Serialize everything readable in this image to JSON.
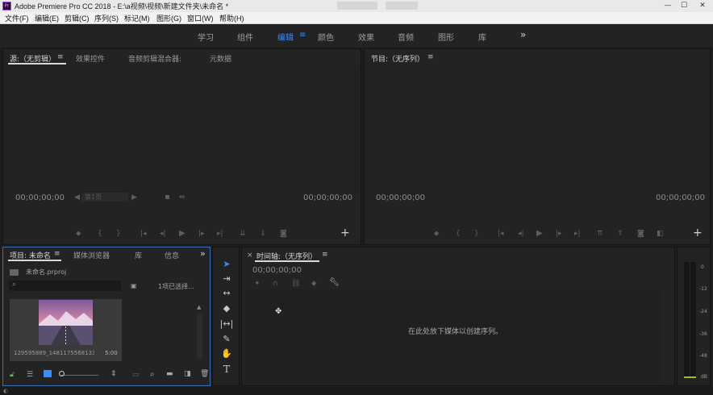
{
  "window": {
    "title": "Adobe Premiere Pro CC 2018 - E:\\a视频\\视频\\新建文件夹\\未命名 *",
    "app_icon": "Pr",
    "minimize": "—",
    "maximize": "☐",
    "close": "✕"
  },
  "menubar": [
    "文件(F)",
    "编辑(E)",
    "剪辑(C)",
    "序列(S)",
    "标记(M)",
    "图形(G)",
    "窗口(W)",
    "帮助(H)"
  ],
  "workspaces": [
    "学习",
    "组件",
    "编辑",
    "颜色",
    "效果",
    "音频",
    "图形",
    "库"
  ],
  "workspace_active": "编辑",
  "workspace_menu_icon": "≡",
  "more_icon": "»",
  "source_panel": {
    "tabs": [
      "源:（无剪辑）",
      "效果控件",
      "音频剪辑混合器:",
      "元数据"
    ],
    "menu_icon": "≡",
    "timecode_left": "00;00;00;00",
    "timecode_right": "00;00;00;00",
    "fit_dropdown": "第1页",
    "add_button": "+"
  },
  "program_panel": {
    "tab": "节目:（无序列）",
    "menu_icon": "≡",
    "timecode_left": "00;00;00;00",
    "timecode_right": "00;00;00;00",
    "add_button": "+"
  },
  "project_panel": {
    "tabs": [
      "项目: 未命名",
      "媒体浏览器",
      "库",
      "信息"
    ],
    "menu_icon": "≡",
    "more_icon": "»",
    "file_name": "未命名.prproj",
    "selection_status": "1项已选择...",
    "clip": {
      "name": "129595889_1481175568133 1nJ...",
      "duration": "5:00"
    }
  },
  "timeline_panel": {
    "close_icon": "×",
    "tab": "时间轴:（无序列）",
    "menu_icon": "≡",
    "timecode": "00;00;00;00",
    "empty_message": "在此处放下媒体以创建序列。"
  },
  "meter": {
    "labels": [
      "0",
      "-12",
      "-24",
      "-36",
      "-48",
      "dB"
    ]
  },
  "colors": {
    "accent": "#3a8bff",
    "panel_bg": "#232323",
    "app_bg": "#1d1d1d"
  }
}
